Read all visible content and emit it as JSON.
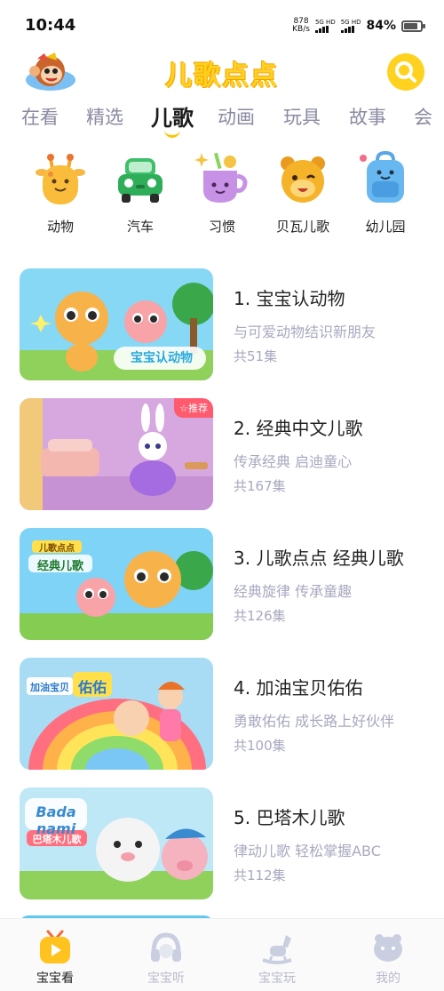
{
  "status_bar": {
    "time": "10:44",
    "net_speed_value": "878",
    "net_speed_unit": "KB/s",
    "sim1_label": "5G HD",
    "sim2_label": "5G HD",
    "battery_percent": "84%",
    "battery_level": 0.84
  },
  "header": {
    "app_name": "儿歌点点",
    "avatar_icon": "monkey-avatar-icon",
    "search_icon": "search-icon",
    "accent_color": "#FFD21F"
  },
  "tabs": [
    {
      "label": "在看",
      "active": false
    },
    {
      "label": "精选",
      "active": false
    },
    {
      "label": "儿歌",
      "active": true
    },
    {
      "label": "动画",
      "active": false
    },
    {
      "label": "玩具",
      "active": false
    },
    {
      "label": "故事",
      "active": false
    },
    {
      "label": "会",
      "active": false
    }
  ],
  "categories": [
    {
      "label": "动物",
      "icon": "giraffe-icon"
    },
    {
      "label": "汽车",
      "icon": "car-icon"
    },
    {
      "label": "习惯",
      "icon": "cup-icon"
    },
    {
      "label": "贝瓦儿歌",
      "icon": "beva-bear-icon"
    },
    {
      "label": "幼儿园",
      "icon": "backpack-icon"
    }
  ],
  "list": [
    {
      "title": "1. 宝宝认动物",
      "subtitle": "与可爱动物结识新朋友",
      "count": "共51集",
      "thumb_text": "宝宝认动物",
      "badge": ""
    },
    {
      "title": "2. 经典中文儿歌",
      "subtitle": "传承经典 启迪童心",
      "count": "共167集",
      "thumb_text": "",
      "badge": "☆推荐"
    },
    {
      "title": "3. 儿歌点点 经典儿歌",
      "subtitle": "经典旋律 传承童趣",
      "count": "共126集",
      "thumb_text_top": "儿歌点点",
      "thumb_text": "经典儿歌",
      "badge": ""
    },
    {
      "title": "4. 加油宝贝佑佑",
      "subtitle": "勇敢佑佑 成长路上好伙伴",
      "count": "共100集",
      "thumb_text_small": "加油宝贝",
      "thumb_text": "佑佑",
      "badge": ""
    },
    {
      "title": "5. 巴塔木儿歌",
      "subtitle": "律动儿歌 轻松掌握ABC",
      "count": "共112集",
      "thumb_text_brand": "Bada nami",
      "thumb_text": "巴塔木儿歌",
      "badge": ""
    }
  ],
  "bottom_nav": [
    {
      "label": "宝宝看",
      "icon": "tv-play-icon",
      "active": true
    },
    {
      "label": "宝宝听",
      "icon": "headphones-icon",
      "active": false
    },
    {
      "label": "宝宝玩",
      "icon": "rocking-horse-icon",
      "active": false
    },
    {
      "label": "我的",
      "icon": "profile-icon",
      "active": false
    }
  ]
}
